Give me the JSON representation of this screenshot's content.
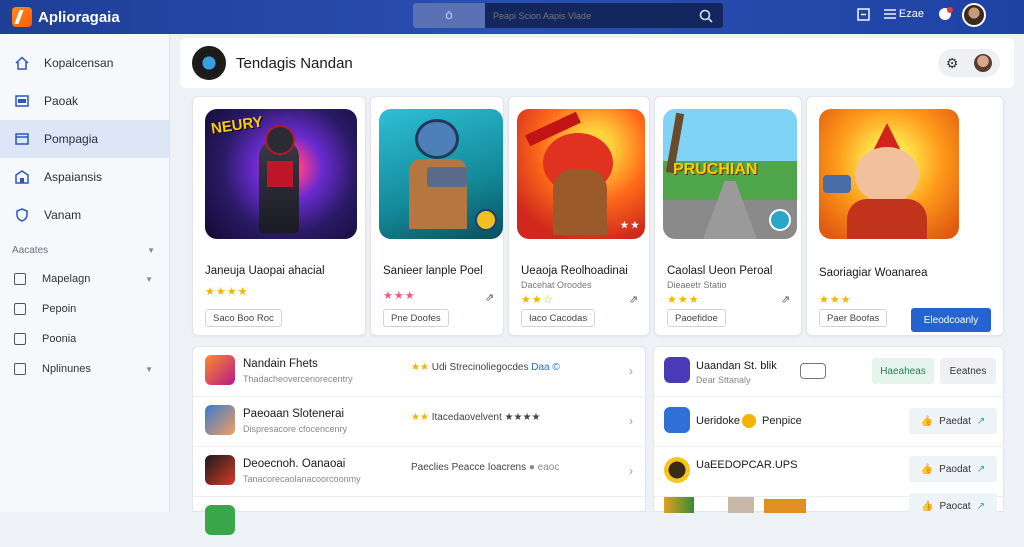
{
  "app": {
    "title": "Aplioragaia"
  },
  "search": {
    "chip_label": "Ö",
    "placeholder": "Peapi Scion Aapis Vlade"
  },
  "topbar": {
    "save_label": "Ezae"
  },
  "sidebar": {
    "items": [
      {
        "label": "Kopalcensan",
        "icon": "home-icon"
      },
      {
        "label": "Paoak",
        "icon": "inbox-icon"
      },
      {
        "label": "Pompagia",
        "icon": "card-icon"
      },
      {
        "label": "Aspaiansis",
        "icon": "store-icon"
      },
      {
        "label": "Vanam",
        "icon": "shield-icon"
      }
    ],
    "section_label": "Aacates",
    "sub_items": [
      {
        "label": "Mapelagn"
      },
      {
        "label": "Pepoin"
      },
      {
        "label": "Poonia"
      },
      {
        "label": "Nplinunes"
      }
    ]
  },
  "header": {
    "title": "Tendagis Nandan"
  },
  "cards": [
    {
      "title": "Janeuja Uaopai ahacial",
      "sub": "",
      "stars": "★★★★",
      "chip": "Saco Boo Roc",
      "art_text": "NEURY"
    },
    {
      "title": "Sanieer lanple Poel",
      "sub": "",
      "stars": "★★★",
      "chip": "Pne Doofes",
      "art_text": ""
    },
    {
      "title": "Ueaoja Reolhoadinai",
      "sub": "Dacehat Oroodes",
      "stars": "★★☆",
      "chip": "Iaco Cacodas",
      "art_text": ""
    },
    {
      "title": "Caolasl Ueon Peroal",
      "sub": "Dieaeetr Statio",
      "stars": "★★★",
      "chip": "Paoefidoe",
      "art_text": "PRUCHIAN"
    },
    {
      "title": "Saoriagiar Woanarea",
      "sub": "",
      "stars": "★★★",
      "chip": "Paer Boofas",
      "art_text": "",
      "cta": "Eleodcoanly"
    }
  ],
  "list": [
    {
      "title": "Nandain Fhets",
      "sub": "Thadacheovercenorecentry",
      "meta_stars": "★★",
      "meta_text": "Udi Strecinoliegocdes",
      "meta_blue": "Daa ©"
    },
    {
      "title": "Paeoaan Slotenerai",
      "sub": "Dispresacore cfocencenry",
      "meta_stars": "★★",
      "meta_text": "Itacedaovelvent ★★★★",
      "meta_blue": ""
    },
    {
      "title": "Deoecnoh. Oanaoai",
      "sub": "Tanacorecaolanacoorcoonmy",
      "meta_stars": "",
      "meta_text": "Paeclies Peacce Ioacrens",
      "meta_blue": "● eaoc"
    }
  ],
  "right_panel": {
    "top": {
      "title": "Uaandan St. blik",
      "sub": "Dear Sttanaly",
      "pill": "Haeaheas",
      "button": "Eeatnes"
    },
    "rows": [
      {
        "title": "Ueridoke",
        "extra": "Penpice",
        "action": "Paedat"
      },
      {
        "title": "UaEEDOPCAR.UPS",
        "extra": "",
        "action": "Paodat"
      },
      {
        "title": "",
        "extra": "",
        "action": "Paocat"
      }
    ]
  },
  "colors": {
    "topbar": "#1f3f96",
    "accent": "#2463d0",
    "star": "#f5b301"
  }
}
